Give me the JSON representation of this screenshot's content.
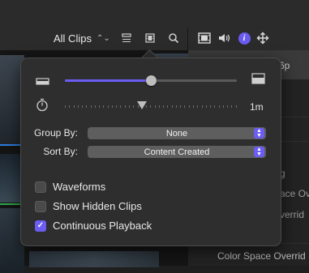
{
  "toolbar": {
    "all_clips_label": "All Clips",
    "icons": [
      "list-view-icon",
      "filmstrip-view-icon",
      "search-icon",
      "video-inspector-icon",
      "audio-inspector-icon",
      "info-inspector-icon",
      "transform-inspector-icon"
    ],
    "info_glyph": "i"
  },
  "inspector": {
    "partial_text_1": "6p",
    "partial_text_2": "g",
    "partial_text_3": "ace Ove",
    "partial_text_4": "verrid",
    "partial_text_5": "Color Space Overrid"
  },
  "popover": {
    "clip_height_slider": {
      "value": 0.5
    },
    "duration_slider": {
      "value": 0.45,
      "label": "1m"
    },
    "group_by": {
      "label": "Group By:",
      "value": "None"
    },
    "sort_by": {
      "label": "Sort By:",
      "value": "Content Created"
    },
    "checkboxes": [
      {
        "label": "Waveforms",
        "checked": false
      },
      {
        "label": "Show Hidden Clips",
        "checked": false
      },
      {
        "label": "Continuous Playback",
        "checked": true
      }
    ]
  },
  "colors": {
    "accent": "#6b5cf2",
    "popover_bg": "#2e2e2e"
  }
}
